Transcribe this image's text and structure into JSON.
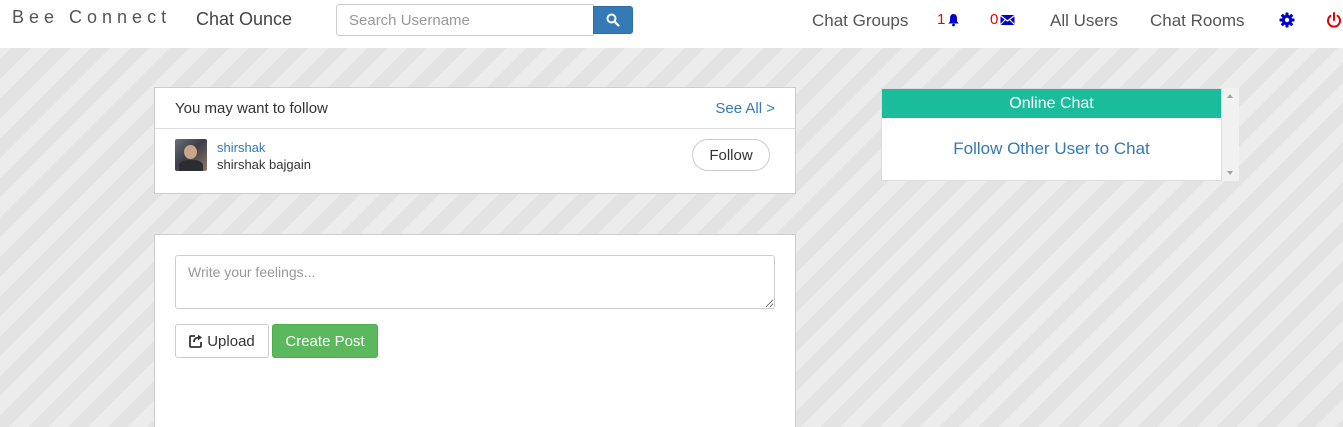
{
  "navbar": {
    "brand": "Bee Connect",
    "app_name": "Chat Ounce",
    "search": {
      "placeholder": "Search Username",
      "value": "",
      "button_icon": "search-icon"
    },
    "links": {
      "chat_groups": "Chat Groups",
      "notifications_count": "1",
      "messages_count": "0",
      "all_users": "All Users",
      "chat_rooms": "Chat Rooms"
    },
    "icons": {
      "notifications": "bell-icon",
      "messages": "envelope-icon",
      "settings": "gear-icon",
      "logout": "power-icon"
    },
    "colors": {
      "count": "#ee0000",
      "icon_blue": "#0000cc",
      "logout": "#e00000"
    }
  },
  "follow_suggestions": {
    "title": "You may want to follow",
    "see_all": "See All >",
    "items": [
      {
        "username": "shirshak",
        "full_name": "shirshak bajgain",
        "follow_label": "Follow"
      }
    ]
  },
  "post_composer": {
    "placeholder": "Write your feelings...",
    "value": "",
    "upload_label": "Upload",
    "upload_icon": "share-icon",
    "create_label": "Create Post"
  },
  "online_chat": {
    "title": "Online Chat",
    "empty_message": "Follow Other User to Chat",
    "accent": "#1abc9c"
  }
}
